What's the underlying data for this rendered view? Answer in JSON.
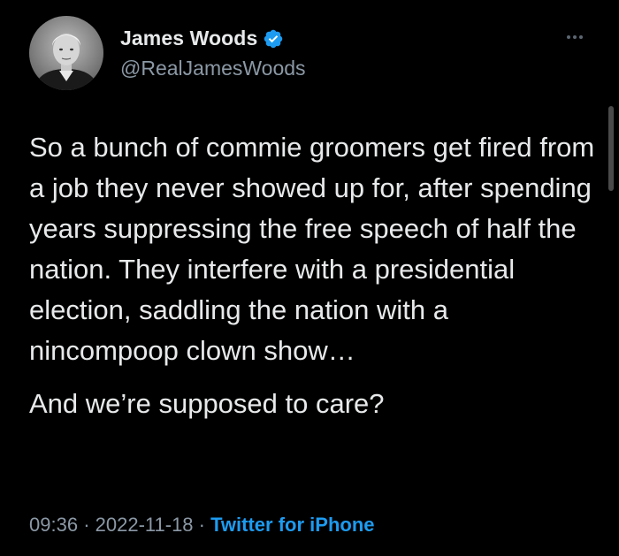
{
  "tweet": {
    "author": {
      "display_name": "James Woods",
      "handle": "@RealJamesWoods",
      "verified_icon": "verified-badge-icon",
      "avatar": "profile-photo"
    },
    "more_icon": "more-horizontal-icon",
    "body_paragraph_1": "So a bunch of commie groomers get fired from a job they never showed up for, after spending years suppressing the free speech of half the nation. They interfere with a presidential election, saddling the nation with a nincompoop clown show…",
    "body_paragraph_2": "And we’re supposed to care?",
    "time": "09:36",
    "separator": "·",
    "date": "2022-11-18",
    "source": "Twitter for iPhone"
  },
  "colors": {
    "background": "#000000",
    "text_primary": "#e7e9ea",
    "text_secondary": "#8b98a5",
    "accent": "#1d9bf0"
  }
}
